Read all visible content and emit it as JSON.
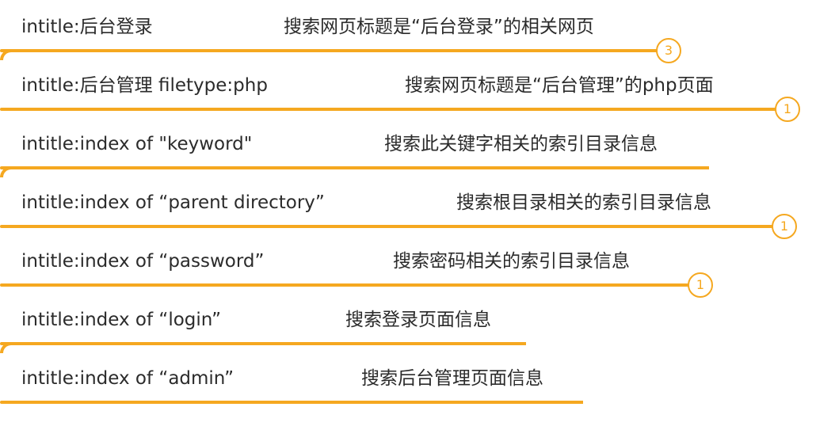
{
  "rows": [
    {
      "command": "intitle:后台登录",
      "description": "搜索网页标题是“后台登录”的相关网页",
      "badge": "3"
    },
    {
      "command": "intitle:后台管理 filetype:php",
      "description": "搜索网页标题是“后台管理”的php页面",
      "badge": "1"
    },
    {
      "command": "intitle:index of \"keyword\"",
      "description": "搜索此关键字相关的索引目录信息",
      "badge": ""
    },
    {
      "command": "intitle:index of “parent directory”",
      "description": "搜索根目录相关的索引目录信息",
      "badge": "1"
    },
    {
      "command": "intitle:index of “password”",
      "description": "搜索密码相关的索引目录信息",
      "badge": "1"
    },
    {
      "command": "intitle:index of “login”",
      "description": "搜索登录页面信息",
      "badge": ""
    },
    {
      "command": "intitle:index of “admin”",
      "description": "搜索后台管理页面信息",
      "badge": ""
    }
  ],
  "colors": {
    "accent": "#f5a820",
    "text": "#2b2b2b"
  }
}
